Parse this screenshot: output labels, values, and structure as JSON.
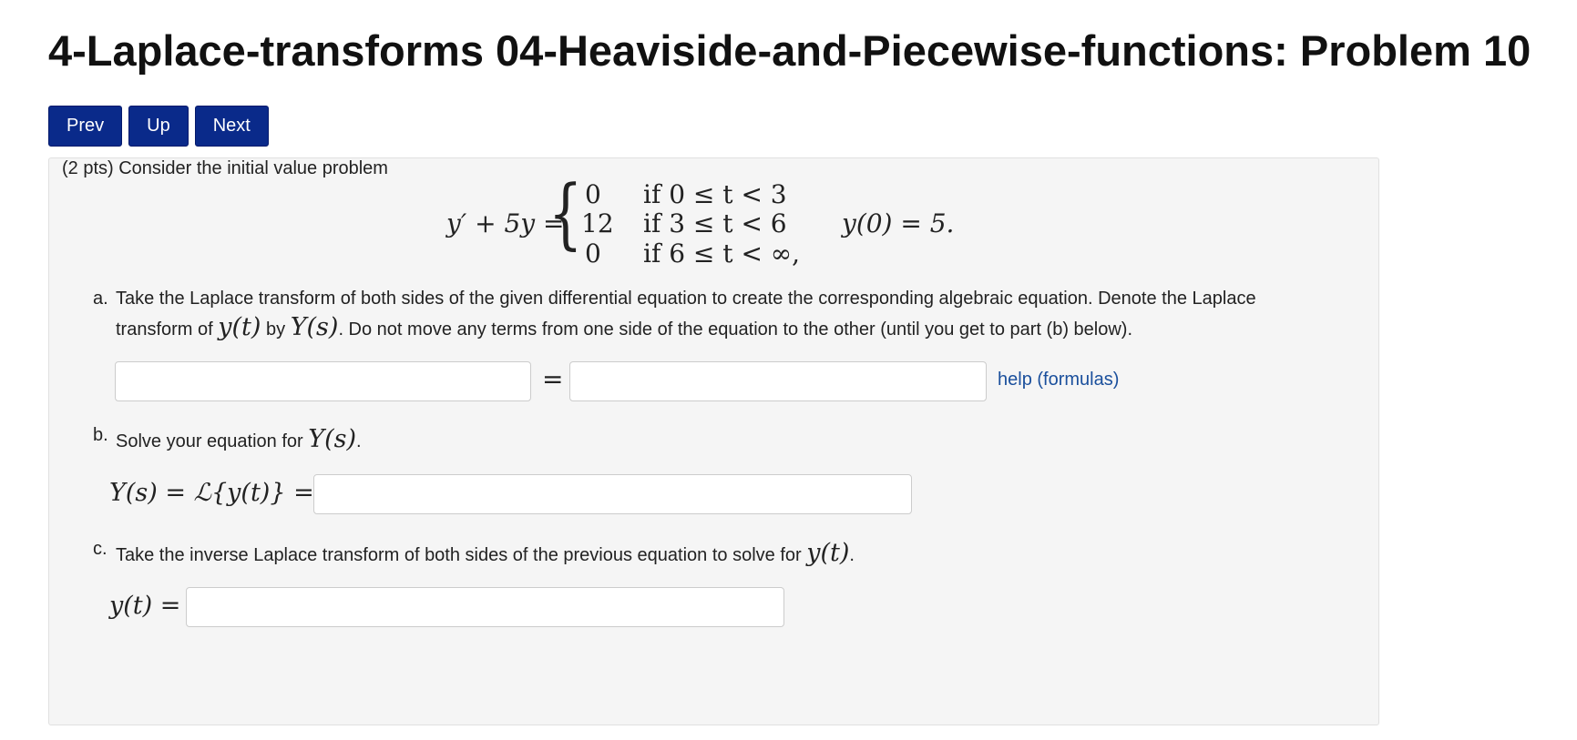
{
  "header": {
    "title": "4-Laplace-transforms 04-Heaviside-and-Piecewise-functions: Problem 10"
  },
  "nav": {
    "prev": "Prev",
    "up": "Up",
    "next": "Next"
  },
  "problem": {
    "intro": "(2 pts) Consider the initial value problem",
    "equation": {
      "lhs": "y′ + 5y =",
      "cases": [
        {
          "value": "0",
          "condition": "if 0 ≤ t < 3"
        },
        {
          "value": "12",
          "condition": "if 3 ≤ t < 6"
        },
        {
          "value": "0",
          "condition": "if 6 ≤ t < ∞,"
        }
      ],
      "initial_condition": "y(0) = 5."
    },
    "part_a": {
      "marker": "a.",
      "line1": "Take the Laplace transform of both sides of the given differential equation to create the corresponding algebraic equation. Denote the Laplace",
      "line2_pre": "transform of",
      "yt": "y(t)",
      "by": "by",
      "Ys": "Y(s)",
      "line2_post": ". Do not move any terms from one side of the equation to the other (until you get to part (b) below).",
      "equals": "=",
      "left_value": "",
      "right_value": "",
      "help_link": "help (formulas)"
    },
    "part_b": {
      "marker": "b.",
      "text": "Solve your equation for",
      "Ys": "Y(s)",
      "period": ".",
      "label": "Y(s) = ℒ{y(t)} =",
      "value": ""
    },
    "part_c": {
      "marker": "c.",
      "text": "Take the inverse Laplace transform of both sides of the previous equation to solve for",
      "yt": "y(t)",
      "period": ".",
      "label": "y(t) =",
      "value": ""
    }
  }
}
